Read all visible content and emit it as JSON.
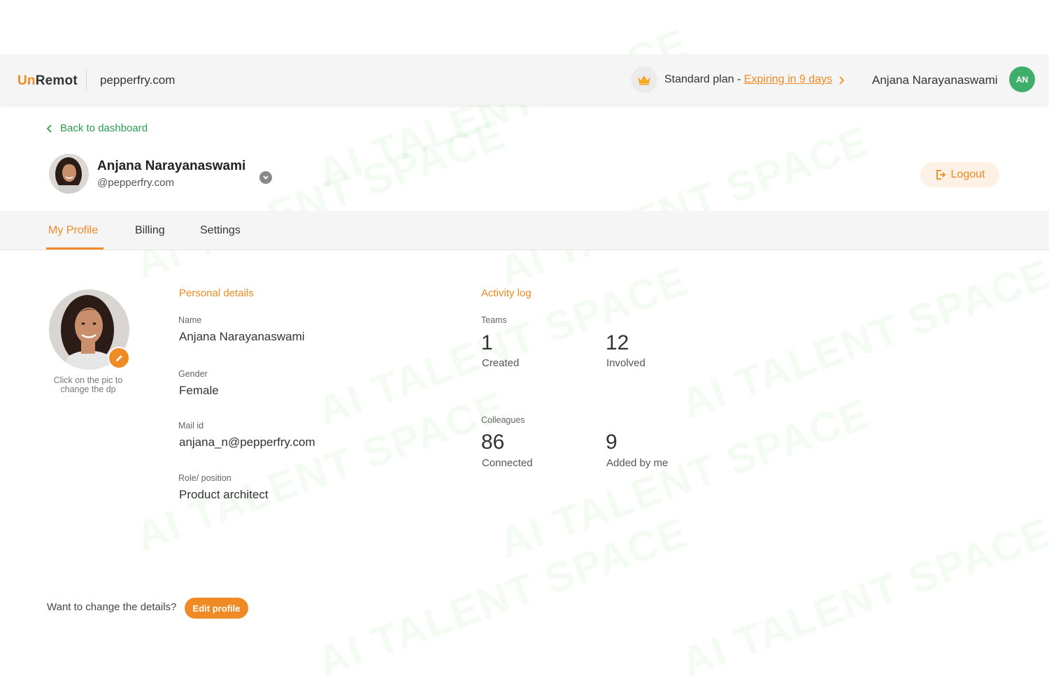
{
  "header": {
    "logo_prefix": "Un",
    "logo_suffix": "Remot",
    "domain": "pepperfry.com",
    "plan_label": "Standard plan - ",
    "plan_link": "Expiring in 9 days",
    "user_name": "Anjana Narayanaswami",
    "user_initials": "AN"
  },
  "profile_header": {
    "back_label": "Back to dashboard",
    "name": "Anjana Narayanaswami",
    "handle": "@pepperfry.com",
    "logout_label": "Logout"
  },
  "tabs": [
    {
      "label": "My Profile",
      "active": true
    },
    {
      "label": "Billing",
      "active": false
    },
    {
      "label": "Settings",
      "active": false
    }
  ],
  "avatar": {
    "hint": "Click on the pic to change the dp"
  },
  "personal_details": {
    "title": "Personal details",
    "fields": [
      {
        "label": "Name",
        "value": "Anjana Narayanaswami"
      },
      {
        "label": "Gender",
        "value": "Female"
      },
      {
        "label": "Mail id",
        "value": "anjana_n@pepperfry.com"
      },
      {
        "label": "Role/ position",
        "value": "Product architect"
      }
    ]
  },
  "activity_log": {
    "title": "Activity log",
    "teams": {
      "label": "Teams",
      "stats": [
        {
          "value": "1",
          "label": "Created"
        },
        {
          "value": "12",
          "label": "Involved"
        }
      ]
    },
    "colleagues": {
      "label": "Colleagues",
      "stats": [
        {
          "value": "86",
          "label": "Connected"
        },
        {
          "value": "9",
          "label": "Added by me"
        }
      ]
    }
  },
  "footer": {
    "question": "Want to change the details?",
    "edit_label": "Edit profile"
  },
  "watermark_text": "AI TALENT SPACE",
  "colors": {
    "accent": "#f08a24",
    "link_green": "#2a9d4a",
    "avatar_green": "#3fae6b"
  },
  "icons": [
    "crown-icon",
    "chevron-right-icon",
    "chevron-left-icon",
    "chevron-down-icon",
    "logout-icon",
    "pencil-icon"
  ]
}
